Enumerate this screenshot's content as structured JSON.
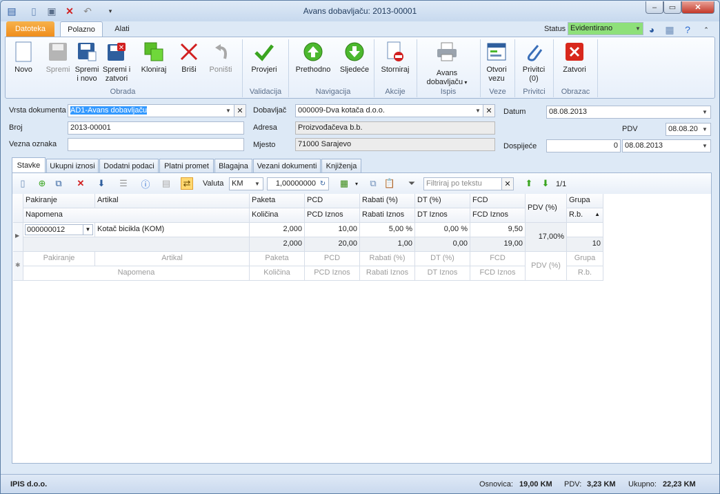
{
  "window": {
    "title": "Avans dobavljaču: 2013-00001"
  },
  "ribbon_tabs": [
    "Datoteka",
    "Polazno",
    "Alati"
  ],
  "status": {
    "label": "Status",
    "value": "Evidentirano"
  },
  "ribbon": {
    "buttons": {
      "novo": "Novo",
      "spremi": "Spremi",
      "spremi_novo": "Spremi i novo",
      "spremi_zatvori": "Spremi i zatvori",
      "kloniraj": "Kloniraj",
      "brisi": "Briši",
      "ponisti": "Poništi",
      "provjeri": "Provjeri",
      "prethodno": "Prethodno",
      "sljedece": "Sljedeće",
      "storniraj": "Storniraj",
      "avans": "Avans dobavljaču",
      "otvori": "Otvori vezu",
      "privitci": "Privitci (0)",
      "zatvori": "Zatvori"
    },
    "groups": {
      "obrada": "Obrada",
      "validacija": "Validacija",
      "navigacija": "Navigacija",
      "akcije": "Akcije",
      "ispis": "Ispis",
      "veze": "Veze",
      "privitci": "Privitci",
      "obrazac": "Obrazac"
    }
  },
  "form": {
    "vrsta_label": "Vrsta dokumenta",
    "vrsta_value": "AD1-Avans dobavljaču",
    "broj_label": "Broj",
    "broj_value": "2013-00001",
    "vezna_label": "Vezna oznaka",
    "vezna_value": "",
    "dobavljac_label": "Dobavljač",
    "dobavljac_value": "000009-Dva kotača d.o.o.",
    "adresa_label": "Adresa",
    "adresa_value": "Proizvođačeva b.b.",
    "mjesto_label": "Mjesto",
    "mjesto_value": "71000 Sarajevo",
    "datum_label": "Datum",
    "datum_value": "08.08.2013",
    "pdv_label": "PDV",
    "pdv_value": "08.08.20",
    "dospijece_label": "Dospijeće",
    "dospijece_days": "0",
    "dospijece_date": "08.08.2013"
  },
  "tabs": [
    "Stavke",
    "Ukupni iznosi",
    "Dodatni podaci",
    "Platni promet",
    "Blagajna",
    "Vezani dokumenti",
    "Knjiženja"
  ],
  "toolbar": {
    "valuta_label": "Valuta",
    "valuta_value": "KM",
    "tecaj": "1,00000000",
    "filter_placeholder": "Filtriraj po tekstu",
    "page": "1/1"
  },
  "grid": {
    "headers_top": [
      "Pakiranje",
      "Artikal",
      "Paketa",
      "PCD",
      "Rabati (%)",
      "DT (%)",
      "FCD",
      "PDV (%)",
      "Grupa"
    ],
    "headers_bottom": [
      "Napomena",
      "Količina",
      "PCD Iznos",
      "Rabati Iznos",
      "DT Iznos",
      "FCD Iznos",
      "R.b."
    ],
    "row": {
      "pakiranje": "000000012",
      "artikal": "Kotač bicikla (KOM)",
      "paketa": "2,000",
      "pcd": "10,00",
      "rabati": "5,00 %",
      "dt": "0,00 %",
      "fcd": "9,50",
      "pdv": "17,00%",
      "kolicina": "2,000",
      "pcd_iznos": "20,00",
      "rabati_iznos": "1,00",
      "dt_iznos": "0,00",
      "fcd_iznos": "19,00",
      "rb": "10"
    }
  },
  "statusbar": {
    "company": "IPIS d.o.o.",
    "osnovica_label": "Osnovica:",
    "osnovica": "19,00 KM",
    "pdv_label": "PDV:",
    "pdv": "3,23 KM",
    "ukupno_label": "Ukupno:",
    "ukupno": "22,23 KM"
  },
  "colors": {
    "accent": "#3399ff",
    "file_tab": "#ef8d1c",
    "status_green": "#8ee07a"
  }
}
